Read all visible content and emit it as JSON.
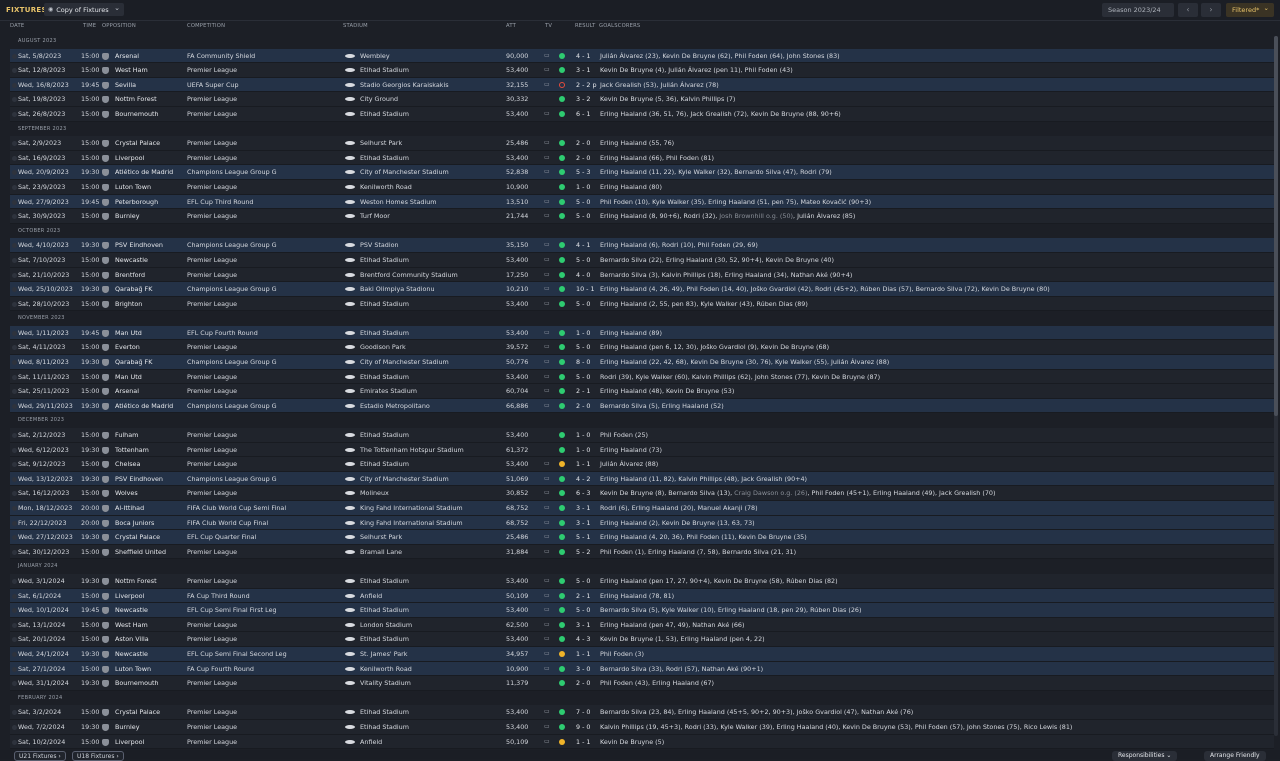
{
  "header": {
    "title": "FIXTURES",
    "view_dropdown": "Copy of Fixtures",
    "season": "Season 2023/24",
    "filter": "Filtered*"
  },
  "columns": {
    "date": "DATE",
    "time": "TIME",
    "opposition": "OPPOSITION",
    "competition": "COMPETITION",
    "stadium": "STADIUM",
    "att": "ATT",
    "tv": "TV",
    "result": "RESULT",
    "goalscorers": "GOALSCORERS"
  },
  "result_colors": {
    "win": "#2ecc71",
    "draw": "#f0b429",
    "loss": "#e74c3c"
  },
  "sections": [
    {
      "month": "AUGUST 2023",
      "fixtures": [
        {
          "date": "Sat, 5/8/2023",
          "time": "15:00",
          "opp": "Arsenal",
          "comp": "FA Community Shield",
          "stadium": "Wembley",
          "att": "90,000",
          "tv": true,
          "res": "W",
          "score": "4 - 1",
          "goals": "Julián Álvarez (23), Kevin De Bruyne (62), Phil Foden (64), John Stones (83)",
          "hl": true
        },
        {
          "date": "Sat, 12/8/2023",
          "time": "15:00",
          "opp": "West Ham",
          "comp": "Premier League",
          "stadium": "Etihad Stadium",
          "att": "53,400",
          "tv": true,
          "res": "W",
          "score": "3 - 1",
          "goals": "Kevin De Bruyne (4), Julián Álvarez (pen 11), Phil Foden (43)"
        },
        {
          "date": "Wed, 16/8/2023",
          "time": "19:45",
          "opp": "Sevilla",
          "comp": "UEFA Super Cup",
          "stadium": "Stadio Georgios Karaiskakis",
          "att": "32,155",
          "tv": true,
          "res": "L",
          "score": "2 - 2 p",
          "goals": "Jack Grealish (53), Julián Álvarez (78)",
          "hl": true
        },
        {
          "date": "Sat, 19/8/2023",
          "time": "15:00",
          "opp": "Nottm Forest",
          "comp": "Premier League",
          "stadium": "City Ground",
          "att": "30,332",
          "tv": false,
          "res": "W",
          "score": "3 - 2",
          "goals": "Kevin De Bruyne (5, 36), Kalvin Phillips (7)"
        },
        {
          "date": "Sat, 26/8/2023",
          "time": "15:00",
          "opp": "Bournemouth",
          "comp": "Premier League",
          "stadium": "Etihad Stadium",
          "att": "53,400",
          "tv": true,
          "res": "W",
          "score": "6 - 1",
          "goals": "Erling Haaland (36, 51, 76), Jack Grealish (72), Kevin De Bruyne (88, 90+6)"
        }
      ]
    },
    {
      "month": "SEPTEMBER 2023",
      "fixtures": [
        {
          "date": "Sat, 2/9/2023",
          "time": "15:00",
          "opp": "Crystal Palace",
          "comp": "Premier League",
          "stadium": "Selhurst Park",
          "att": "25,486",
          "tv": true,
          "res": "W",
          "score": "2 - 0",
          "goals": "Erling Haaland (55, 76)"
        },
        {
          "date": "Sat, 16/9/2023",
          "time": "15:00",
          "opp": "Liverpool",
          "comp": "Premier League",
          "stadium": "Etihad Stadium",
          "att": "53,400",
          "tv": true,
          "res": "W",
          "score": "2 - 0",
          "goals": "Erling Haaland (66), Phil Foden (81)"
        },
        {
          "date": "Wed, 20/9/2023",
          "time": "19:30",
          "opp": "Atlético de Madrid",
          "comp": "Champions League Group G",
          "stadium": "City of Manchester Stadium",
          "att": "52,838",
          "tv": true,
          "res": "W",
          "score": "5 - 3",
          "goals": "Erling Haaland (11, 22), Kyle Walker (32), Bernardo Silva (47), Rodri (79)",
          "hl": true
        },
        {
          "date": "Sat, 23/9/2023",
          "time": "15:00",
          "opp": "Luton Town",
          "comp": "Premier League",
          "stadium": "Kenilworth Road",
          "att": "10,900",
          "tv": false,
          "res": "W",
          "score": "1 - 0",
          "goals": "Erling Haaland (80)"
        },
        {
          "date": "Wed, 27/9/2023",
          "time": "19:45",
          "opp": "Peterborough",
          "comp": "EFL Cup Third Round",
          "stadium": "Weston Homes Stadium",
          "att": "13,510",
          "tv": true,
          "res": "W",
          "score": "5 - 0",
          "goals": "Phil Foden (10), Kyle Walker (35), Erling Haaland (51, pen 75), Mateo Kovačić (90+3)",
          "hl": true
        },
        {
          "date": "Sat, 30/9/2023",
          "time": "15:00",
          "opp": "Burnley",
          "comp": "Premier League",
          "stadium": "Turf Moor",
          "att": "21,744",
          "tv": true,
          "res": "W",
          "score": "5 - 0",
          "goals": "Erling Haaland (8, 90+6), Rodri (32), ",
          "og": "Josh Brownhill o.g. (50)",
          "goals2": ", Julián Álvarez (85)"
        }
      ]
    },
    {
      "month": "OCTOBER 2023",
      "fixtures": [
        {
          "date": "Wed, 4/10/2023",
          "time": "19:30",
          "opp": "PSV Eindhoven",
          "comp": "Champions League Group G",
          "stadium": "PSV Stadion",
          "att": "35,150",
          "tv": true,
          "res": "W",
          "score": "4 - 1",
          "goals": "Erling Haaland (6), Rodri (10), Phil Foden (29, 69)",
          "hl": true
        },
        {
          "date": "Sat, 7/10/2023",
          "time": "15:00",
          "opp": "Newcastle",
          "comp": "Premier League",
          "stadium": "Etihad Stadium",
          "att": "53,400",
          "tv": true,
          "res": "W",
          "score": "5 - 0",
          "goals": "Bernardo Silva (22), Erling Haaland (30, 52, 90+4), Kevin De Bruyne (40)"
        },
        {
          "date": "Sat, 21/10/2023",
          "time": "15:00",
          "opp": "Brentford",
          "comp": "Premier League",
          "stadium": "Brentford Community Stadium",
          "att": "17,250",
          "tv": true,
          "res": "W",
          "score": "4 - 0",
          "goals": "Bernardo Silva (3), Kalvin Phillips (18), Erling Haaland (34), Nathan Aké (90+4)"
        },
        {
          "date": "Wed, 25/10/2023",
          "time": "19:30",
          "opp": "Qarabağ FK",
          "comp": "Champions League Group G",
          "stadium": "Baki Olimpiya Stadionu",
          "att": "10,210",
          "tv": true,
          "res": "W",
          "score": "10 - 1",
          "goals": "Erling Haaland (4, 26, 49), Phil Foden (14, 40), Joško Gvardiol (42), Rodri (45+2), Rúben Dias (57), Bernardo Silva (72), Kevin De Bruyne (80)",
          "hl": true
        },
        {
          "date": "Sat, 28/10/2023",
          "time": "15:00",
          "opp": "Brighton",
          "comp": "Premier League",
          "stadium": "Etihad Stadium",
          "att": "53,400",
          "tv": true,
          "res": "W",
          "score": "5 - 0",
          "goals": "Erling Haaland (2, 55, pen 83), Kyle Walker (43), Rúben Dias (89)"
        }
      ]
    },
    {
      "month": "NOVEMBER 2023",
      "fixtures": [
        {
          "date": "Wed, 1/11/2023",
          "time": "19:45",
          "opp": "Man Utd",
          "comp": "EFL Cup Fourth Round",
          "stadium": "Etihad Stadium",
          "att": "53,400",
          "tv": true,
          "res": "W",
          "score": "1 - 0",
          "goals": "Erling Haaland (89)",
          "hl": true
        },
        {
          "date": "Sat, 4/11/2023",
          "time": "15:00",
          "opp": "Everton",
          "comp": "Premier League",
          "stadium": "Goodison Park",
          "att": "39,572",
          "tv": true,
          "res": "W",
          "score": "5 - 0",
          "goals": "Erling Haaland (pen 6, 12, 30), Joško Gvardiol (9), Kevin De Bruyne (68)"
        },
        {
          "date": "Wed, 8/11/2023",
          "time": "19:30",
          "opp": "Qarabağ FK",
          "comp": "Champions League Group G",
          "stadium": "City of Manchester Stadium",
          "att": "50,776",
          "tv": true,
          "res": "W",
          "score": "8 - 0",
          "goals": "Erling Haaland (22, 42, 68), Kevin De Bruyne (30, 76), Kyle Walker (55), Julián Álvarez (88)",
          "hl": true
        },
        {
          "date": "Sat, 11/11/2023",
          "time": "15:00",
          "opp": "Man Utd",
          "comp": "Premier League",
          "stadium": "Etihad Stadium",
          "att": "53,400",
          "tv": true,
          "res": "W",
          "score": "5 - 0",
          "goals": "Rodri (39), Kyle Walker (60), Kalvin Phillips (62), John Stones (77), Kevin De Bruyne (87)"
        },
        {
          "date": "Sat, 25/11/2023",
          "time": "15:00",
          "opp": "Arsenal",
          "comp": "Premier League",
          "stadium": "Emirates Stadium",
          "att": "60,704",
          "tv": true,
          "res": "W",
          "score": "2 - 1",
          "goals": "Erling Haaland (48), Kevin De Bruyne (53)"
        },
        {
          "date": "Wed, 29/11/2023",
          "time": "19:30",
          "opp": "Atlético de Madrid",
          "comp": "Champions League Group G",
          "stadium": "Estadio Metropolitano",
          "att": "66,886",
          "tv": true,
          "res": "W",
          "score": "2 - 0",
          "goals": "Bernardo Silva (5), Erling Haaland (52)",
          "hl": true
        }
      ]
    },
    {
      "month": "DECEMBER 2023",
      "fixtures": [
        {
          "date": "Sat, 2/12/2023",
          "time": "15:00",
          "opp": "Fulham",
          "comp": "Premier League",
          "stadium": "Etihad Stadium",
          "att": "53,400",
          "tv": false,
          "res": "W",
          "score": "1 - 0",
          "goals": "Phil Foden (25)"
        },
        {
          "date": "Wed, 6/12/2023",
          "time": "19:30",
          "opp": "Tottenham",
          "comp": "Premier League",
          "stadium": "The Tottenham Hotspur Stadium",
          "att": "61,372",
          "tv": false,
          "res": "W",
          "score": "1 - 0",
          "goals": "Erling Haaland (73)"
        },
        {
          "date": "Sat, 9/12/2023",
          "time": "15:00",
          "opp": "Chelsea",
          "comp": "Premier League",
          "stadium": "Etihad Stadium",
          "att": "53,400",
          "tv": true,
          "res": "D",
          "score": "1 - 1",
          "goals": "Julián Álvarez (88)"
        },
        {
          "date": "Wed, 13/12/2023",
          "time": "19:30",
          "opp": "PSV Eindhoven",
          "comp": "Champions League Group G",
          "stadium": "City of Manchester Stadium",
          "att": "51,069",
          "tv": true,
          "res": "W",
          "score": "4 - 2",
          "goals": "Erling Haaland (11, 82), Kalvin Phillips (48), Jack Grealish (90+4)",
          "hl": true
        },
        {
          "date": "Sat, 16/12/2023",
          "time": "15:00",
          "opp": "Wolves",
          "comp": "Premier League",
          "stadium": "Molineux",
          "att": "30,852",
          "tv": true,
          "res": "W",
          "score": "6 - 3",
          "goals": "Kevin De Bruyne (8), Bernardo Silva (13), ",
          "og": "Craig Dawson o.g. (26)",
          "goals2": ", Phil Foden (45+1), Erling Haaland (49), Jack Grealish (70)"
        },
        {
          "date": "Mon, 18/12/2023",
          "time": "20:00",
          "opp": "Al-Ittihad",
          "comp": "FIFA Club World Cup Semi Final",
          "stadium": "King Fahd International Stadium",
          "att": "68,752",
          "tv": true,
          "res": "W",
          "score": "3 - 1",
          "goals": "Rodri (6), Erling Haaland (20), Manuel Akanji (78)",
          "hl": true
        },
        {
          "date": "Fri, 22/12/2023",
          "time": "20:00",
          "opp": "Boca Juniors",
          "comp": "FIFA Club World Cup Final",
          "stadium": "King Fahd International Stadium",
          "att": "68,752",
          "tv": true,
          "res": "W",
          "score": "3 - 1",
          "goals": "Erling Haaland (2), Kevin De Bruyne (13, 63, 73)",
          "hl": true
        },
        {
          "date": "Wed, 27/12/2023",
          "time": "19:30",
          "opp": "Crystal Palace",
          "comp": "EFL Cup Quarter Final",
          "stadium": "Selhurst Park",
          "att": "25,486",
          "tv": true,
          "res": "W",
          "score": "5 - 1",
          "goals": "Erling Haaland (4, 20, 36), Phil Foden (11), Kevin De Bruyne (35)",
          "hl": true
        },
        {
          "date": "Sat, 30/12/2023",
          "time": "15:00",
          "opp": "Sheffield United",
          "comp": "Premier League",
          "stadium": "Bramall Lane",
          "att": "31,884",
          "tv": true,
          "res": "W",
          "score": "5 - 2",
          "goals": "Phil Foden (1), Erling Haaland (7, 58), Bernardo Silva (21, 31)"
        }
      ]
    },
    {
      "month": "JANUARY 2024",
      "fixtures": [
        {
          "date": "Wed, 3/1/2024",
          "time": "19:30",
          "opp": "Nottm Forest",
          "comp": "Premier League",
          "stadium": "Etihad Stadium",
          "att": "53,400",
          "tv": true,
          "res": "W",
          "score": "5 - 0",
          "goals": "Erling Haaland (pen 17, 27, 90+4), Kevin De Bruyne (58), Rúben Dias (82)"
        },
        {
          "date": "Sat, 6/1/2024",
          "time": "15:00",
          "opp": "Liverpool",
          "comp": "FA Cup Third Round",
          "stadium": "Anfield",
          "att": "50,109",
          "tv": true,
          "res": "W",
          "score": "2 - 1",
          "goals": "Erling Haaland (78, 81)",
          "hl": true
        },
        {
          "date": "Wed, 10/1/2024",
          "time": "19:45",
          "opp": "Newcastle",
          "comp": "EFL Cup Semi Final First Leg",
          "stadium": "Etihad Stadium",
          "att": "53,400",
          "tv": true,
          "res": "W",
          "score": "5 - 0",
          "goals": "Bernardo Silva (5), Kyle Walker (10), Erling Haaland (18, pen 29), Rúben Dias (26)",
          "hl": true
        },
        {
          "date": "Sat, 13/1/2024",
          "time": "15:00",
          "opp": "West Ham",
          "comp": "Premier League",
          "stadium": "London Stadium",
          "att": "62,500",
          "tv": true,
          "res": "W",
          "score": "3 - 1",
          "goals": "Erling Haaland (pen 47, 49), Nathan Aké (66)"
        },
        {
          "date": "Sat, 20/1/2024",
          "time": "15:00",
          "opp": "Aston Villa",
          "comp": "Premier League",
          "stadium": "Etihad Stadium",
          "att": "53,400",
          "tv": true,
          "res": "W",
          "score": "4 - 3",
          "goals": "Kevin De Bruyne (1, 53), Erling Haaland (pen 4, 22)"
        },
        {
          "date": "Wed, 24/1/2024",
          "time": "19:30",
          "opp": "Newcastle",
          "comp": "EFL Cup Semi Final Second Leg",
          "stadium": "St. James' Park",
          "att": "34,957",
          "tv": true,
          "res": "D",
          "score": "1 - 1",
          "goals": "Phil Foden (3)",
          "hl": true
        },
        {
          "date": "Sat, 27/1/2024",
          "time": "15:00",
          "opp": "Luton Town",
          "comp": "FA Cup Fourth Round",
          "stadium": "Kenilworth Road",
          "att": "10,900",
          "tv": true,
          "res": "W",
          "score": "3 - 0",
          "goals": "Bernardo Silva (33), Rodri (57), Nathan Aké (90+1)",
          "hl": true
        },
        {
          "date": "Wed, 31/1/2024",
          "time": "19:30",
          "opp": "Bournemouth",
          "comp": "Premier League",
          "stadium": "Vitality Stadium",
          "att": "11,379",
          "tv": false,
          "res": "W",
          "score": "2 - 0",
          "goals": "Phil Foden (43), Erling Haaland (67)"
        }
      ]
    },
    {
      "month": "FEBRUARY 2024",
      "fixtures": [
        {
          "date": "Sat, 3/2/2024",
          "time": "15:00",
          "opp": "Crystal Palace",
          "comp": "Premier League",
          "stadium": "Etihad Stadium",
          "att": "53,400",
          "tv": true,
          "res": "W",
          "score": "7 - 0",
          "goals": "Bernardo Silva (23, 84), Erling Haaland (45+5, 90+2, 90+3), Joško Gvardiol (47), Nathan Aké (76)"
        },
        {
          "date": "Wed, 7/2/2024",
          "time": "19:30",
          "opp": "Burnley",
          "comp": "Premier League",
          "stadium": "Etihad Stadium",
          "att": "53,400",
          "tv": true,
          "res": "W",
          "score": "9 - 0",
          "goals": "Kalvin Phillips (19, 45+3), Rodri (33), Kyle Walker (39), Erling Haaland (40), Kevin De Bruyne (53), Phil Foden (57), John Stones (75), Rico Lewis (81)"
        },
        {
          "date": "Sat, 10/2/2024",
          "time": "15:00",
          "opp": "Liverpool",
          "comp": "Premier League",
          "stadium": "Anfield",
          "att": "50,109",
          "tv": true,
          "res": "D",
          "score": "1 - 1",
          "goals": "Kevin De Bruyne (5)"
        }
      ]
    }
  ],
  "footer": {
    "tab1": "U21 Fixtures",
    "tab2": "U18 Fixtures",
    "responsibilities": "Responsibilities",
    "arrange": "Arrange Friendly"
  }
}
